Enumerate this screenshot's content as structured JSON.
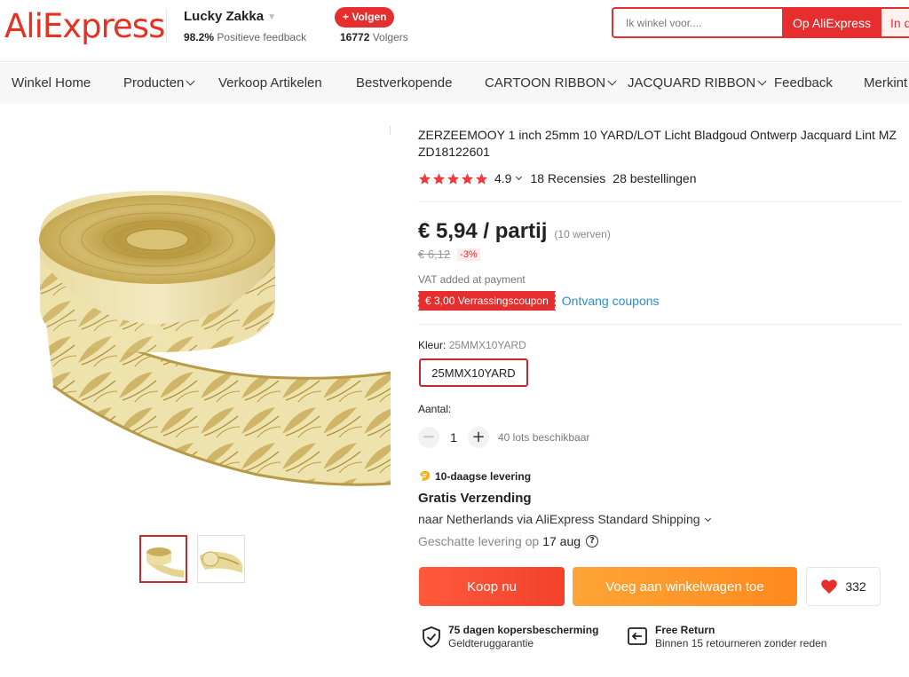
{
  "header": {
    "logo": "AliExpress",
    "store_name": "Lucky Zakka",
    "feedback_percent": "98.2%",
    "feedback_label": "Positieve feedback",
    "follow_label": "+ Volgen",
    "followers_count": "16772",
    "followers_label": "Volgers",
    "search_placeholder": "Ik winkel voor....",
    "search_ali_label": "Op AliExpress",
    "search_store_label": "In d"
  },
  "nav": {
    "items": [
      {
        "label": "Winkel Home",
        "has_dropdown": false
      },
      {
        "label": "Producten",
        "has_dropdown": true
      },
      {
        "label": "Verkoop Artikelen",
        "has_dropdown": false
      },
      {
        "label": "Bestverkopende",
        "has_dropdown": false
      },
      {
        "label": "CARTOON RIBBON",
        "has_dropdown": true
      },
      {
        "label": "JACQUARD RIBBON",
        "has_dropdown": true
      },
      {
        "label": "Feedback",
        "has_dropdown": false
      },
      {
        "label": "Merkint",
        "has_dropdown": false
      }
    ]
  },
  "product": {
    "title": "ZERZEEMOOY 1 inch 25mm 10 YARD/LOT Licht Bladgoud Ontwerp Jacquard Lint MZ ZD18122601",
    "rating": "4.9",
    "stars": 5,
    "reviews": "18 Recensies",
    "orders": "28 bestellingen",
    "price": "€ 5,94 / partij",
    "price_note": "(10 werven)",
    "old_price": "€ 6,12",
    "discount": "-3%",
    "vat_note": "VAT added at payment",
    "coupon_label": "€ 3,00 Verrassingscoupon",
    "coupon_link": "Ontvang coupons",
    "color_label": "Kleur:",
    "color_value": "25MMX10YARD",
    "variant_option": "25MMX10YARD",
    "quantity_label": "Aantal:",
    "quantity_minus": "−",
    "quantity_value": "1",
    "quantity_plus": "+",
    "quantity_available": "40 lots beschikbaar",
    "delivery_badge": "10-daagse levering",
    "shipping_title": "Gratis Verzending",
    "shipping_route": "naar Netherlands via AliExpress Standard Shipping",
    "est_delivery_label": "Geschatte levering op",
    "est_delivery_date": "17 aug",
    "help_icon": "?",
    "buy_label": "Koop nu",
    "cart_label": "Voeg aan winkelwagen toe",
    "wishlist_count": "332"
  },
  "guarantees": [
    {
      "title": "75 dagen kopersbescherming",
      "subtitle": "Geldteruggarantie",
      "icon": "shield-check-icon"
    },
    {
      "title": "Free Return",
      "subtitle": "Binnen 15 retourneren zonder reden",
      "icon": "return-icon"
    }
  ],
  "colors": {
    "brand_red": "#e62e2e",
    "buy_orange_red": "#f3412a",
    "cart_orange": "#ff8a1e",
    "star_red": "#ef3b3b",
    "link_blue": "#2b8fd0",
    "gold": "#d8c27a"
  }
}
